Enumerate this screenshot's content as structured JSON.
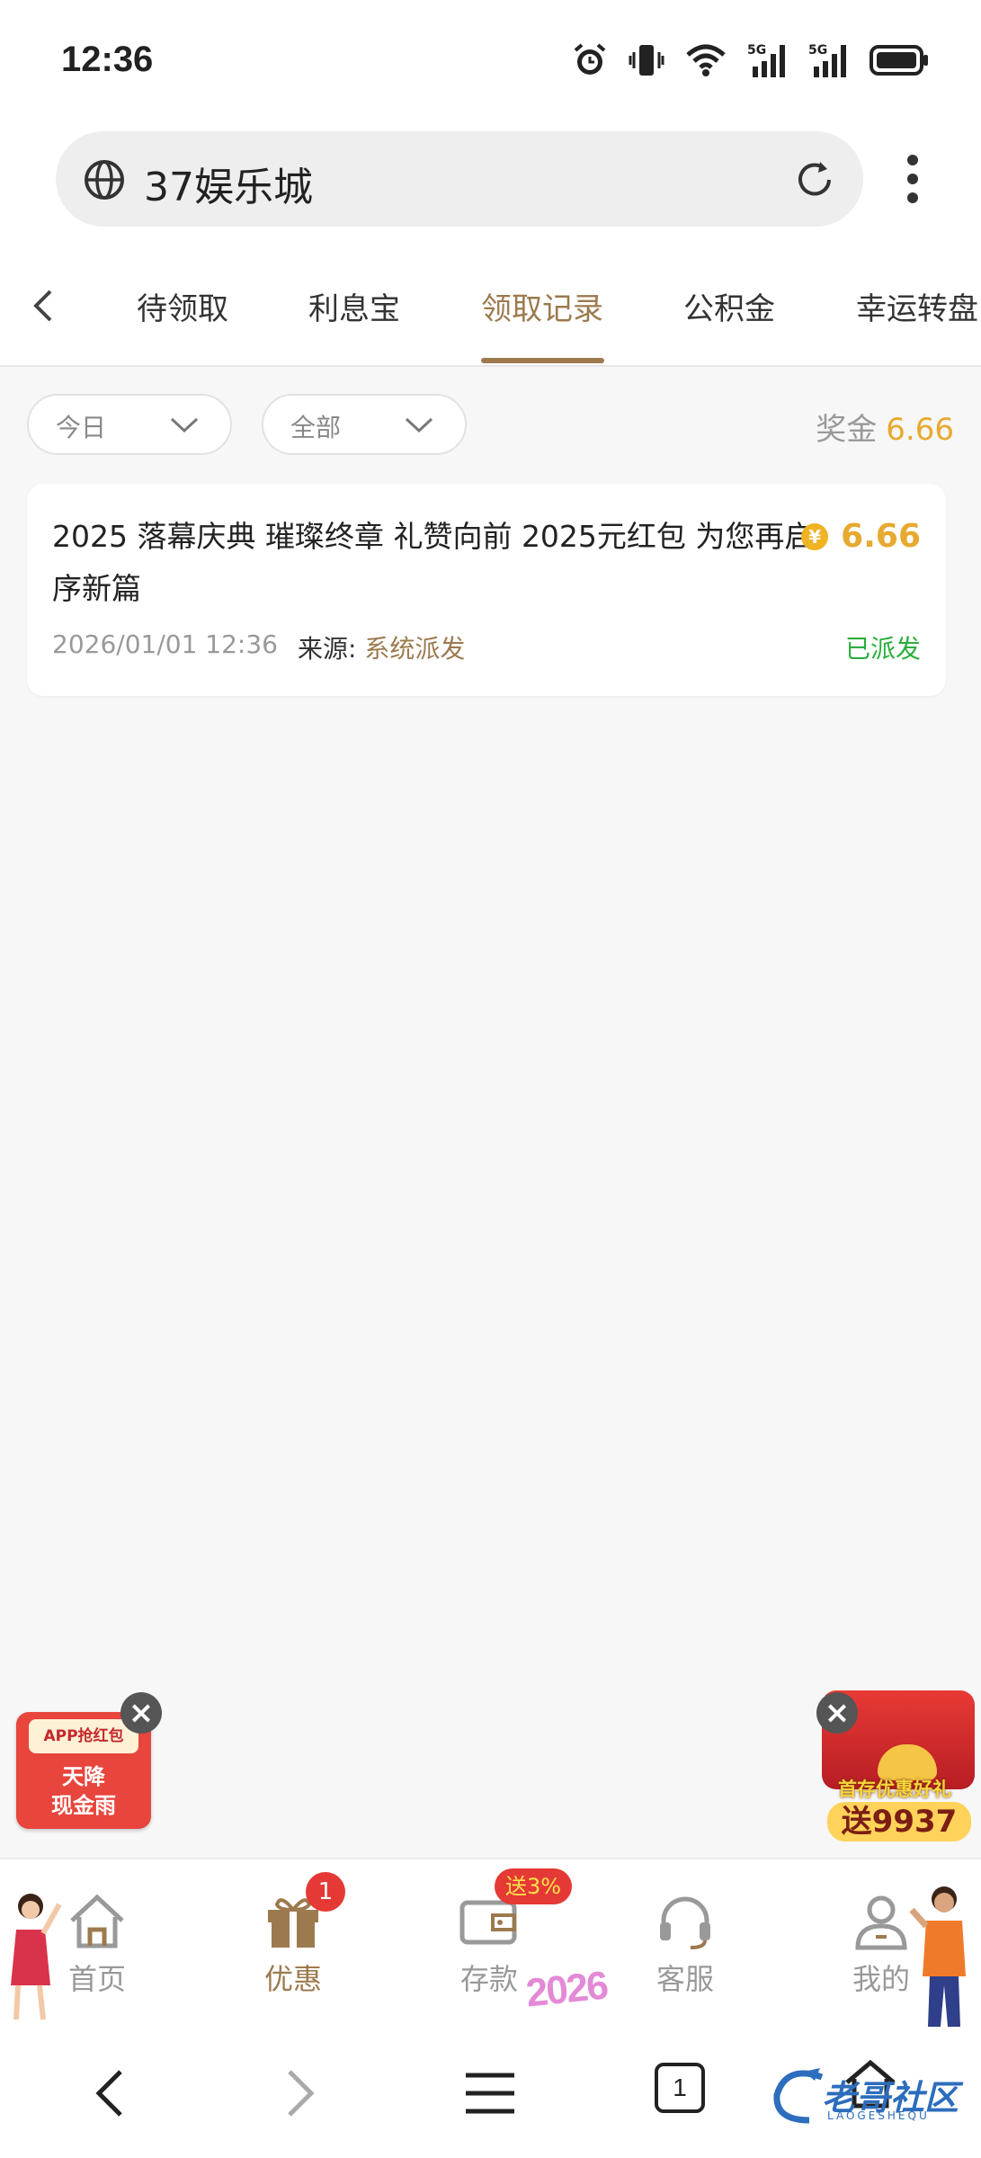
{
  "status_bar": {
    "time": "12:36"
  },
  "browser": {
    "url_text": "37娱乐城"
  },
  "tabs": [
    {
      "label": "待领取"
    },
    {
      "label": "利息宝"
    },
    {
      "label": "领取记录"
    },
    {
      "label": "公积金"
    },
    {
      "label": "幸运转盘"
    }
  ],
  "active_tab": "领取记录",
  "filters": {
    "date": "今日",
    "type": "全部"
  },
  "bonus": {
    "label": "奖金",
    "value": "6.66"
  },
  "records": [
    {
      "title": "2025 落幕庆典 璀璨终章 礼赞向前 2025元红包 为您再启序新篇",
      "amount": "6.66",
      "coin_symbol": "¥",
      "time": "2026/01/01 12:36",
      "source_label": "来源:",
      "source_value": "系统派发",
      "status": "已派发"
    }
  ],
  "promos": {
    "left": {
      "top_text": "APP抢红包",
      "line1": "天降",
      "line2": "现金雨"
    },
    "right": {
      "text": "首存优惠好礼",
      "prefix": "送",
      "number": "9937"
    }
  },
  "bottom_nav": {
    "items": [
      {
        "label": "首页",
        "icon": "home-icon"
      },
      {
        "label": "优惠",
        "icon": "gift-icon",
        "badge": "1"
      },
      {
        "label": "存款",
        "icon": "wallet-icon",
        "badge": "送3%"
      },
      {
        "label": "客服",
        "icon": "headset-icon"
      },
      {
        "label": "我的",
        "icon": "user-icon"
      }
    ],
    "decoration_text": "2026"
  },
  "system_nav": {
    "tab_count": "1"
  },
  "watermark": {
    "text": "老哥社区",
    "sub": "LAOGESHEQU"
  },
  "colors": {
    "accent": "#9c7a4e",
    "gold": "#e7a92f",
    "success": "#2bae3d",
    "badge": "#e53935"
  }
}
